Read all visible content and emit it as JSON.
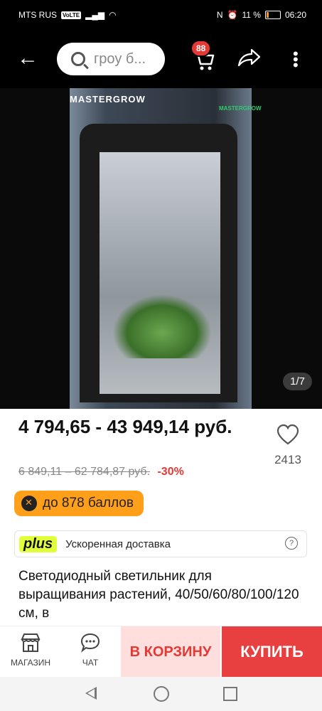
{
  "status_bar": {
    "carrier": "MTS RUS",
    "volte": "VoLTE",
    "battery": "11 %",
    "time": "06:20"
  },
  "top_nav": {
    "search_placeholder": "гроу б...",
    "cart_count": "88"
  },
  "gallery": {
    "brand": "MASTERGROW",
    "brand_small": "MASTERGROW",
    "counter": "1/7"
  },
  "price": {
    "current": "4 794,65 - 43 949,14 руб.",
    "old": "6 849,11 – 62 784,87 руб.",
    "discount": "-30%",
    "favorites_count": "2413"
  },
  "points": {
    "label": "до 878 баллов"
  },
  "delivery": {
    "badge": "plus",
    "text": "Ускоренная доставка",
    "help": "?"
  },
  "product": {
    "title": "Светодиодный светильник для выращивания растений, 40/50/60/80/100/120 см, в"
  },
  "action_bar": {
    "store_label": "МАГАЗИН",
    "chat_label": "ЧАТ",
    "add_to_cart_label": "В КОРЗИНУ",
    "buy_label": "КУПИТЬ"
  },
  "colors": {
    "accent_red": "#e53935",
    "buy_bg": "#e84040",
    "cart_btn_bg": "#ffdede",
    "points_bg": "#ff9f1a",
    "plus_bg": "#e2ff3b"
  }
}
